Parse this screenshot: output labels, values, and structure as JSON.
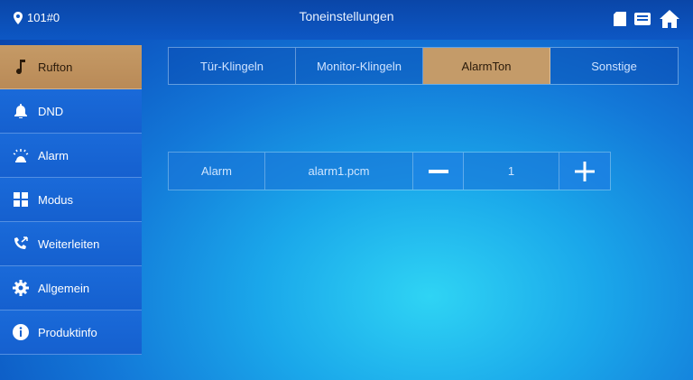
{
  "header": {
    "room": "101#0",
    "title": "Toneinstellungen",
    "icons": [
      "sd-card-icon",
      "message-icon",
      "home-icon"
    ]
  },
  "sidebar": {
    "items": [
      {
        "label": "Rufton",
        "icon": "music-note-icon",
        "active": true
      },
      {
        "label": "DND",
        "icon": "bell-icon",
        "active": false
      },
      {
        "label": "Alarm",
        "icon": "alarm-siren-icon",
        "active": false
      },
      {
        "label": "Modus",
        "icon": "grid-icon",
        "active": false
      },
      {
        "label": "Weiterleiten",
        "icon": "call-forward-icon",
        "active": false
      },
      {
        "label": "Allgemein",
        "icon": "gear-icon",
        "active": false
      },
      {
        "label": "Produktinfo",
        "icon": "info-icon",
        "active": false
      }
    ]
  },
  "tabs": [
    {
      "label": "Tür-Klingeln",
      "active": false
    },
    {
      "label": "Monitor-Klingeln",
      "active": false
    },
    {
      "label": "AlarmTon",
      "active": true
    },
    {
      "label": "Sonstige",
      "active": false
    }
  ],
  "alarm_row": {
    "label": "Alarm",
    "file": "alarm1.pcm",
    "volume": "1",
    "minus_icon": "minus-icon",
    "plus_icon": "plus-icon"
  },
  "colors": {
    "active": "#c49b69",
    "accent_blue": "#1378d8"
  }
}
